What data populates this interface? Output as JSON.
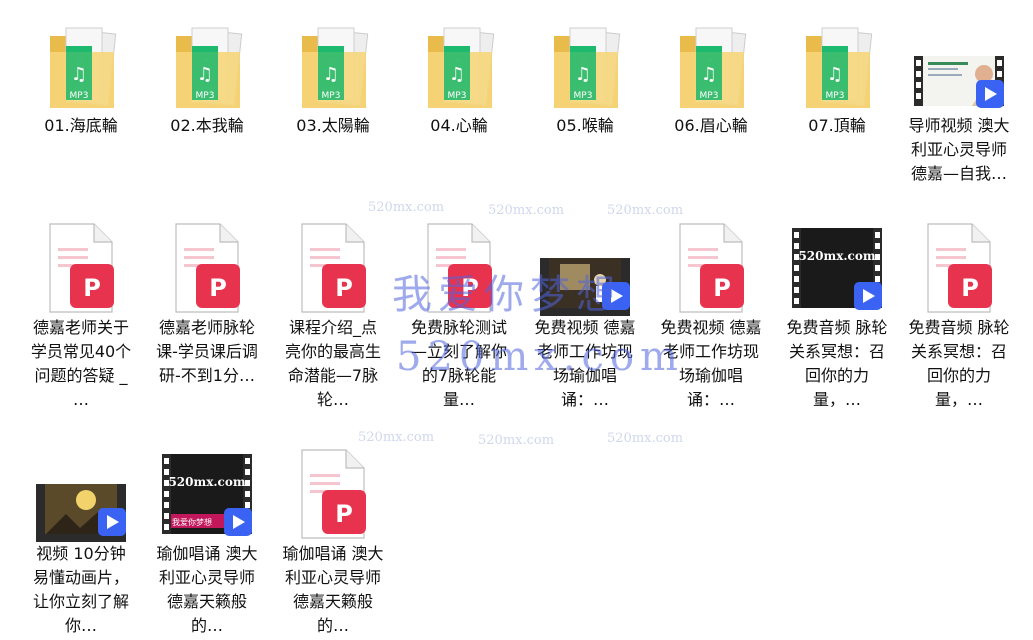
{
  "colors": {
    "folder": "#f6d67a",
    "folder_dark": "#e8bb4a",
    "mp3_green": "#1db96f",
    "pdf_red": "#e8334f",
    "video_badge": "#3a63f3"
  },
  "watermarks": {
    "site_small": "520mx.com",
    "big_cn": "我爱你梦想",
    "big_url": "520mx.com"
  },
  "thumbs": {
    "site_logo": "520mx.com",
    "dream_tag": "我爱你梦想"
  },
  "items": [
    {
      "name": "01.海底輪",
      "type": "folder-mp3"
    },
    {
      "name": "02.本我輪",
      "type": "folder-mp3"
    },
    {
      "name": "03.太陽輪",
      "type": "folder-mp3"
    },
    {
      "name": "04.心輪",
      "type": "folder-mp3"
    },
    {
      "name": "05.喉輪",
      "type": "folder-mp3"
    },
    {
      "name": "06.眉心輪",
      "type": "folder-mp3"
    },
    {
      "name": "07.頂輪",
      "type": "folder-mp3"
    },
    {
      "name": "导师视频 澳大利亚心灵导师德嘉—自我…",
      "type": "video-person"
    },
    {
      "name": "德嘉老师关于学员常见40个问题的答疑 _ …",
      "type": "pdf"
    },
    {
      "name": "德嘉老师脉轮课-学员课后调研-不到1分…",
      "type": "pdf"
    },
    {
      "name": "课程介绍_点亮你的最高生命潜能—7脉轮…",
      "type": "pdf"
    },
    {
      "name": "免费脉轮测试—立刻了解你的7脉轮能量…",
      "type": "pdf"
    },
    {
      "name": "免费视频 德嘉老师工作坊现场瑜伽唱诵：…",
      "type": "video-stage"
    },
    {
      "name": "免费视频 德嘉老师工作坊现场瑜伽唱诵：…",
      "type": "pdf"
    },
    {
      "name": "免费音频 脉轮关系冥想：召回你的力量，…",
      "type": "video-logo"
    },
    {
      "name": "免费音频 脉轮关系冥想：召回你的力量，…",
      "type": "pdf"
    },
    {
      "name": "视频 10分钟易懂动画片，让你立刻了解你…",
      "type": "video-anim"
    },
    {
      "name": "瑜伽唱诵 澳大利亚心灵导师德嘉天籁般的…",
      "type": "video-logo2"
    },
    {
      "name": "瑜伽唱诵 澳大利亚心灵导师德嘉天籁般的…",
      "type": "pdf"
    }
  ]
}
